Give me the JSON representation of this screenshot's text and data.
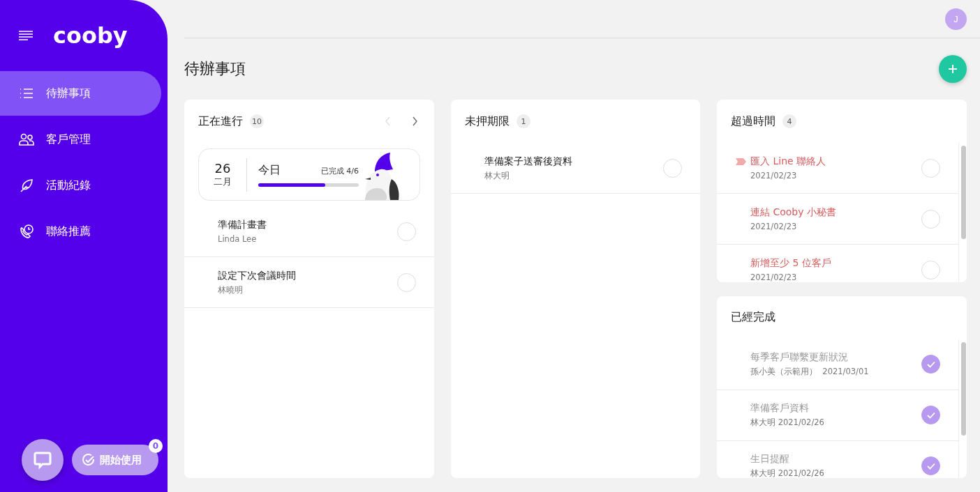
{
  "sidebar": {
    "logo": "cooby",
    "items": [
      {
        "label": "待辦事項",
        "selected": true
      },
      {
        "label": "客戶管理",
        "selected": false
      },
      {
        "label": "活動紀錄",
        "selected": false
      },
      {
        "label": "聯絡推薦",
        "selected": false
      }
    ],
    "start_button": {
      "label": "開始使用",
      "badge": "0"
    }
  },
  "user_avatar": {
    "initial": "J"
  },
  "page_title": "待辦事項",
  "columns": [
    {
      "panels": [
        {
          "title": "正在進行",
          "count": "10",
          "scrollbar": false,
          "pager": {
            "prev_disabled": true,
            "next_disabled": false
          },
          "today": {
            "day": "26",
            "month": "二月",
            "label": "今日",
            "progress_text": "已完成 4/6",
            "level": 0.667
          },
          "tasks": [
            {
              "title": "準備計畫書",
              "subtitle": "Linda Lee",
              "checked": false,
              "overdue": false,
              "flagged": false
            },
            {
              "title": "設定下次會議時間",
              "subtitle": "林曉明",
              "checked": false,
              "overdue": false,
              "flagged": false
            }
          ]
        }
      ]
    },
    {
      "panels": [
        {
          "title": "未押期限",
          "count": "1",
          "scrollbar": false,
          "tasks": [
            {
              "title": "準備案子送審後資料",
              "subtitle": "林大明",
              "checked": false,
              "overdue": false,
              "flagged": false
            }
          ]
        }
      ]
    },
    {
      "panels": [
        {
          "title": "超過時間",
          "count": "4",
          "scrollbar": true,
          "tasks": [
            {
              "title": "匯入 Line 聯絡人",
              "subtitle": "2021/02/23",
              "checked": false,
              "overdue": true,
              "flagged": true
            },
            {
              "title": "連結 Cooby 小秘書",
              "subtitle": "2021/02/23",
              "checked": false,
              "overdue": true,
              "flagged": false
            },
            {
              "title": "新增至少 5 位客戶",
              "subtitle": "2021/02/23",
              "checked": false,
              "overdue": true,
              "flagged": false
            }
          ]
        },
        {
          "title": "已經完成",
          "scrollbar": true,
          "tasks": [
            {
              "title": "每季客戶聯繫更新狀況",
              "subtitle": "孫小美（示範用）  2021/03/01",
              "checked": true,
              "overdue": false,
              "flagged": false
            },
            {
              "title": "準備客戶資料",
              "subtitle": "林大明 2021/02/26",
              "checked": true,
              "overdue": false,
              "flagged": false
            },
            {
              "title": "生日提醒",
              "subtitle": "林大明 2021/02/26",
              "checked": true,
              "overdue": false,
              "flagged": false
            }
          ]
        }
      ]
    }
  ]
}
